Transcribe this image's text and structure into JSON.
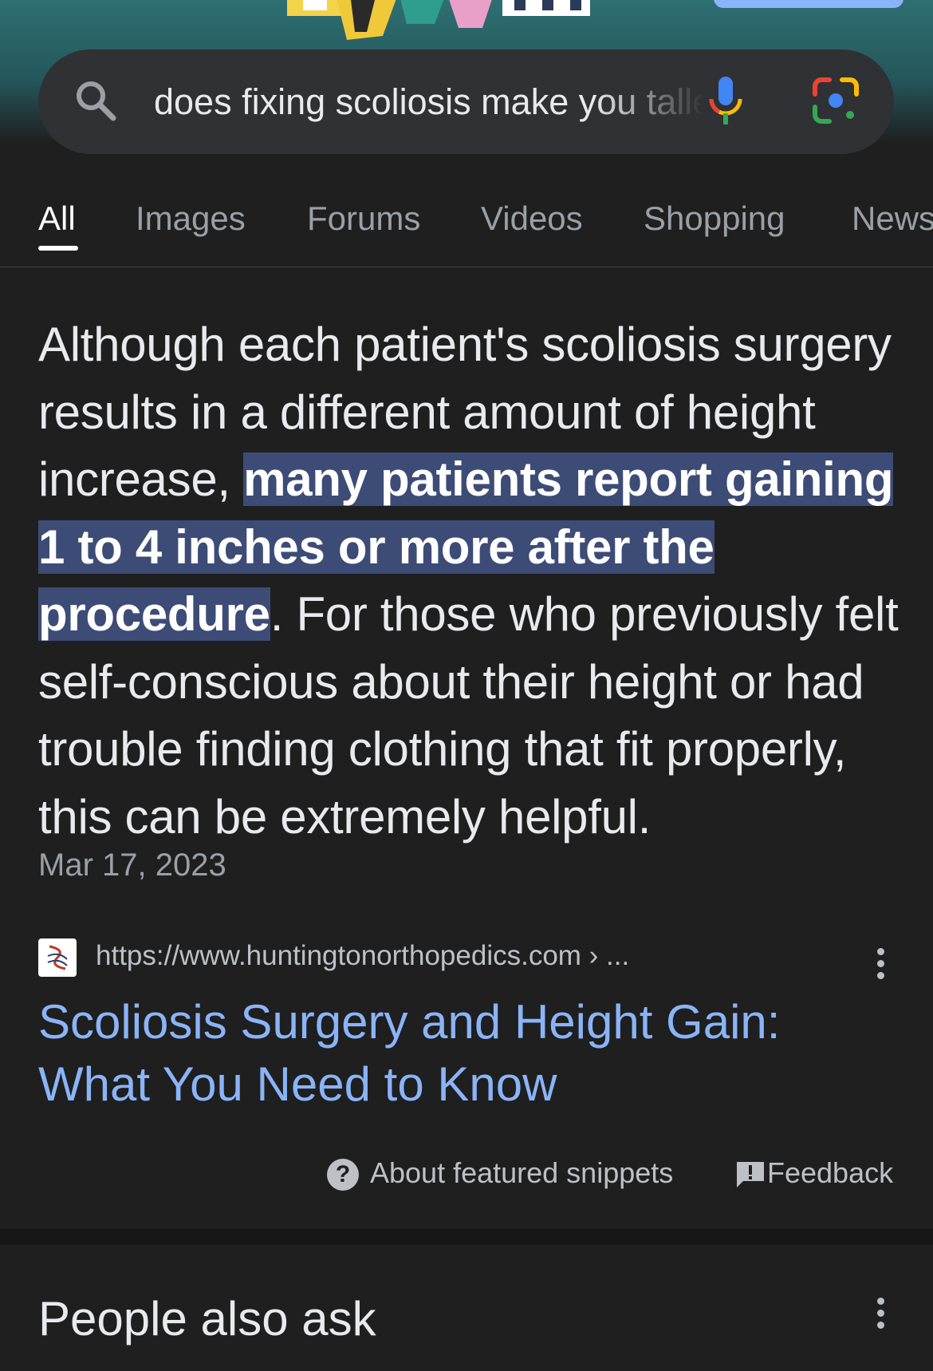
{
  "search": {
    "query": "does fixing scoliosis make you taller"
  },
  "tabs": [
    {
      "label": "All",
      "active": true
    },
    {
      "label": "Images"
    },
    {
      "label": "Forums"
    },
    {
      "label": "Videos"
    },
    {
      "label": "Shopping"
    },
    {
      "label": "News"
    }
  ],
  "snippet": {
    "text_before": "Although each patient's scoliosis surgery results in a different amount of height increase, ",
    "highlighted": "many patients report gaining 1 to 4 inches or more after the procedure",
    "text_after": ". For those who previously felt self-conscious about their height or had trouble finding clothing that fit properly, this can be extremely helpful.",
    "date": "Mar 17, 2023"
  },
  "source": {
    "url": "https://www.huntingtonorthopedics.com › ...",
    "title": "Scoliosis Surgery and Height Gain: What You Need to Know"
  },
  "footer_links": {
    "about": "About featured snippets",
    "feedback": "Feedback"
  },
  "people_also_ask": {
    "heading": "People also ask"
  },
  "icons": {
    "search": "search-icon",
    "mic": "mic-icon",
    "lens": "google-lens-icon",
    "more": "more-vert-icon",
    "help": "help-icon",
    "feedback": "feedback-icon"
  },
  "colors": {
    "background": "#1f1f1f",
    "link": "#8ab4f8",
    "highlight": "#3d4c76"
  }
}
